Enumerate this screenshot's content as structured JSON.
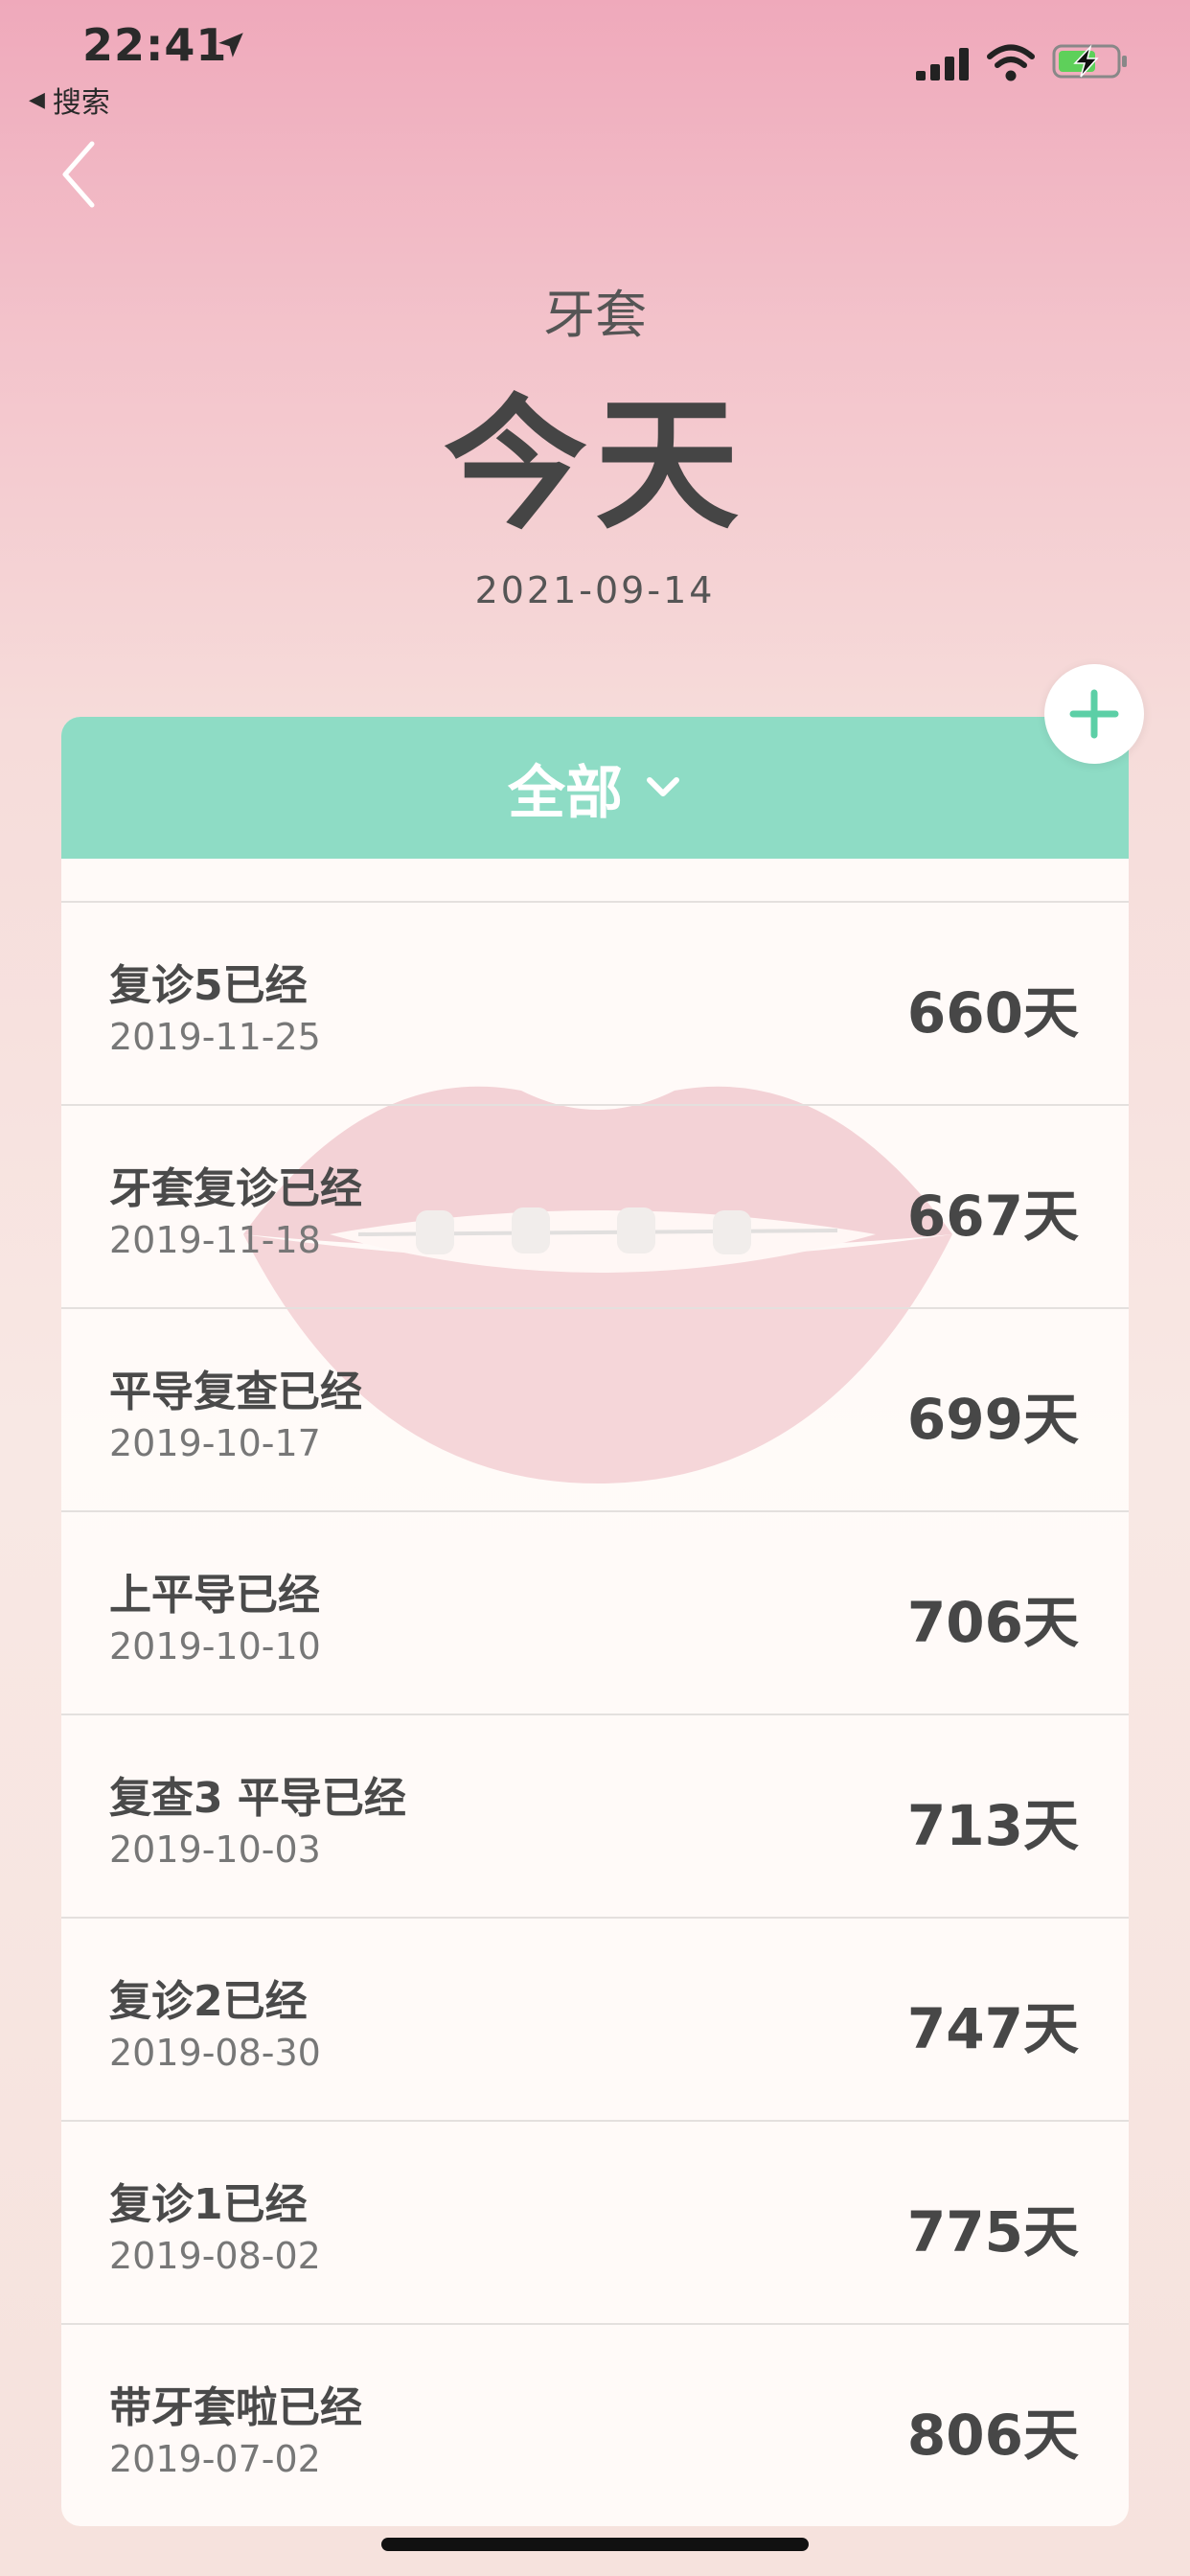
{
  "status_bar": {
    "time": "22:41",
    "back_app_label": "搜索"
  },
  "header": {
    "subtitle": "牙套",
    "title": "今天",
    "date": "2021-09-14"
  },
  "filter": {
    "label": "全部"
  },
  "colors": {
    "accent": "#8edcc5",
    "text": "#4a4a4a"
  },
  "items": [
    {
      "name": "复诊5已经",
      "date": "2019-11-25",
      "days": "660天"
    },
    {
      "name": "牙套复诊已经",
      "date": "2019-11-18",
      "days": "667天"
    },
    {
      "name": "平导复查已经",
      "date": "2019-10-17",
      "days": "699天"
    },
    {
      "name": "上平导已经",
      "date": "2019-10-10",
      "days": "706天"
    },
    {
      "name": "复查3 平导已经",
      "date": "2019-10-03",
      "days": "713天"
    },
    {
      "name": "复诊2已经",
      "date": "2019-08-30",
      "days": "747天"
    },
    {
      "name": "复诊1已经",
      "date": "2019-08-02",
      "days": "775天"
    },
    {
      "name": "带牙套啦已经",
      "date": "2019-07-02",
      "days": "806天"
    }
  ]
}
